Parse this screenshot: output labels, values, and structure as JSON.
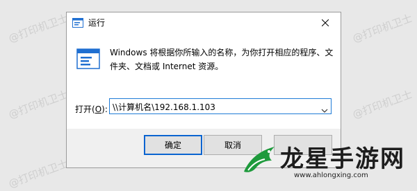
{
  "watermark": "@打印机卫士",
  "dialog": {
    "title": "运行",
    "description": "Windows 将根据你所输入的名称，为你打开相应的程序、文件夹、文档或 Internet 资源。",
    "open_label_prefix": "打开(",
    "open_label_accel": "O",
    "open_label_suffix": "):",
    "input_value": "\\\\计算机名\\192.168.1.103",
    "buttons": {
      "ok": "确定",
      "cancel": "取消",
      "browse": ""
    },
    "icons": {
      "title": "run-icon",
      "content": "run-icon",
      "close": "close-icon",
      "dropdown": "chevron-down-icon"
    }
  },
  "overlay_logo": {
    "title": "龙星手游网",
    "url": "www.ahlongxing.com"
  },
  "colors": {
    "accent": "#0a64d0",
    "focus_border": "#1e7bd6",
    "logo_green": "#1e9a3c"
  }
}
